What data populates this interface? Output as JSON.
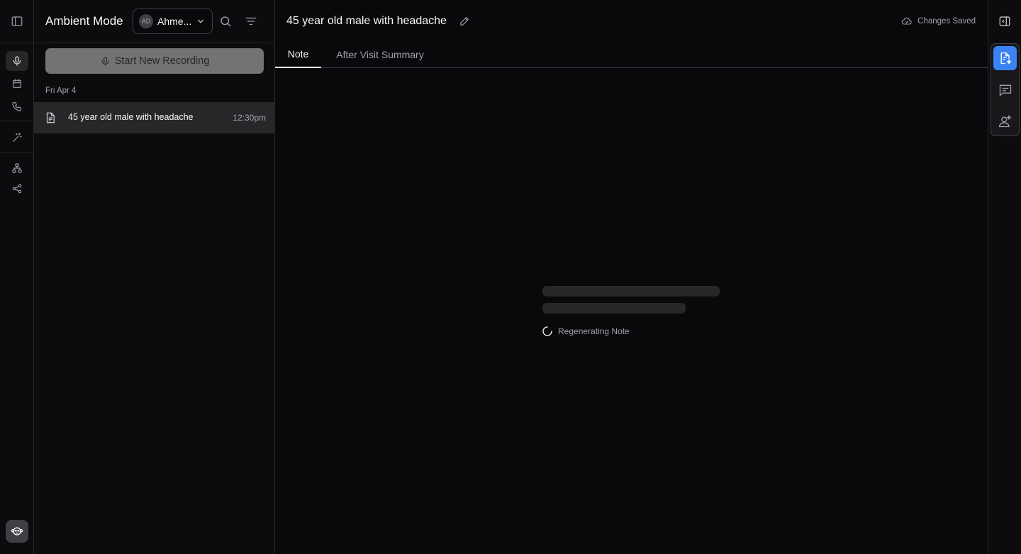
{
  "rail": {
    "items": [
      {
        "name": "sidebar-toggle-icon"
      },
      {
        "name": "microphone-icon",
        "active": true
      },
      {
        "name": "calendar-icon"
      },
      {
        "name": "phone-icon"
      },
      {
        "name": "magic-wand-icon"
      },
      {
        "name": "hierarchy-icon"
      },
      {
        "name": "share-icon"
      }
    ],
    "avatar_icon": "monkey-avatar-icon"
  },
  "sessions": {
    "title": "Ambient Mode",
    "provider": {
      "initials": "AD",
      "name": "Ahme..."
    },
    "record_button": "Start New Recording",
    "date_group": "Fri Apr 4",
    "items": [
      {
        "title": "45 year old male with headache",
        "time": "12:30pm",
        "icon": "document-icon"
      }
    ]
  },
  "main": {
    "title": "45 year old male with headache",
    "status": "Changes Saved",
    "tabs": [
      {
        "label": "Note",
        "active": true
      },
      {
        "label": "After Visit Summary",
        "active": false
      }
    ],
    "loading_text": "Regenerating Note"
  },
  "right_rail": {
    "tools": [
      {
        "name": "note-ai-icon",
        "active": true
      },
      {
        "name": "chat-icon",
        "active": false
      },
      {
        "name": "patient-ai-icon",
        "active": false
      }
    ]
  },
  "colors": {
    "background": "#09090b",
    "border": "#27272a",
    "accent": "#3b82f6",
    "record_button": "#737373"
  }
}
